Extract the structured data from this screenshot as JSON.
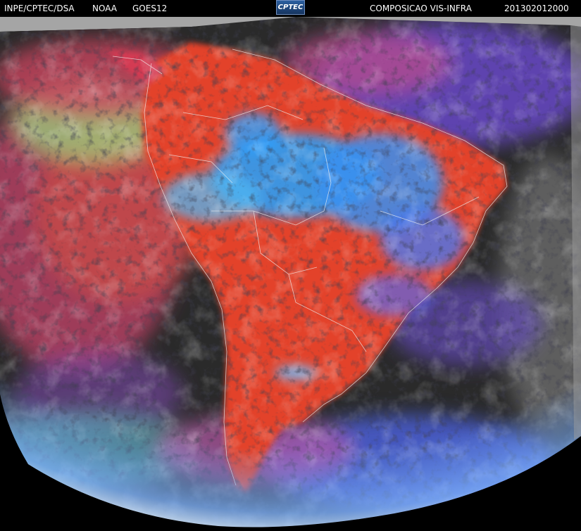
{
  "header": {
    "institution": "INPE/CPTEC/DSA",
    "agency": "NOAA",
    "satellite": "GOES12",
    "product": "COMPOSICAO VIS-INFRA",
    "timestamp": "201302012000"
  },
  "logo": {
    "text": "CPTEC"
  },
  "image": {
    "subject": "satellite composite image of South America with clouds",
    "colors": {
      "space": "#000000",
      "ocean": "#2a2a2a",
      "land": "#e3432c",
      "convection": "#2f9cf3",
      "high_cloud": "#6c4bd1",
      "low_cloud_green": "#9ad07c",
      "limb": "#6ea9ff",
      "offdisk_gray": "#a5a5a5"
    }
  }
}
